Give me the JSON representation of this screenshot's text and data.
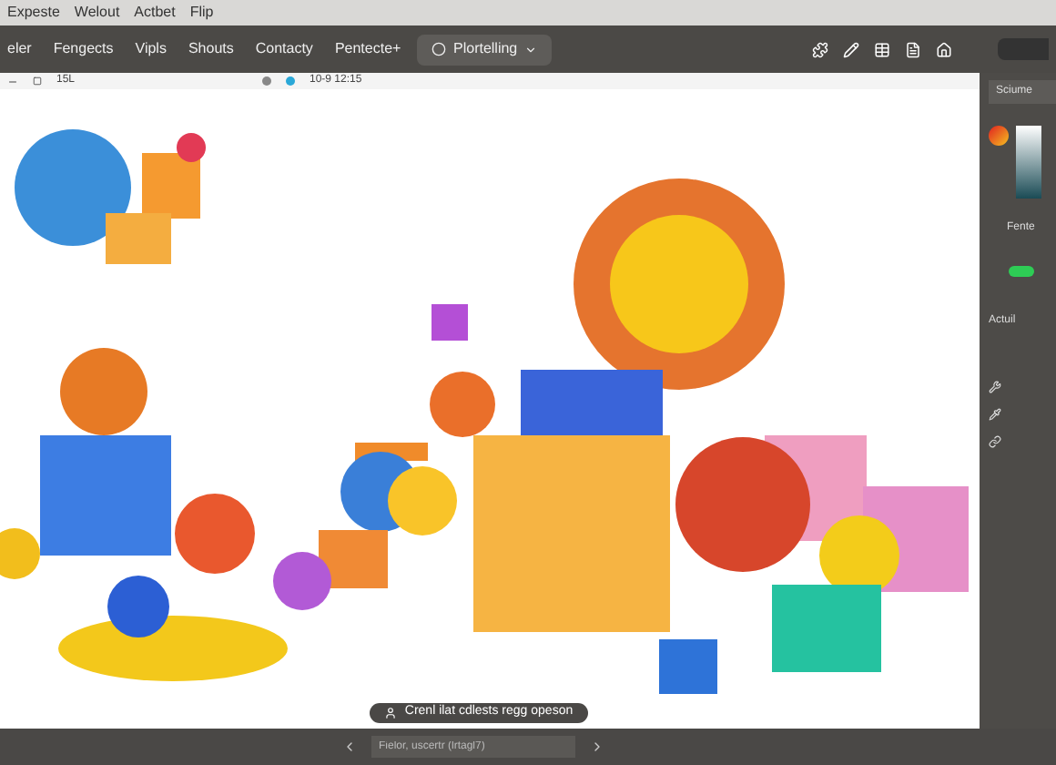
{
  "menu": [
    "Expeste",
    "Welout",
    "Actbet",
    "Flip"
  ],
  "nav": [
    "eler",
    "Fengects",
    "Vipls",
    "Shouts",
    "Contacty",
    "Pentecte+"
  ],
  "dropdown": {
    "label": "Plortelling"
  },
  "info": {
    "size": "15L",
    "time": "10-9 12:15"
  },
  "panel": {
    "tab": "Sciume",
    "section": "Fente",
    "tab2": "Actuil",
    "toggle_on": true
  },
  "toast": "Crenl ilat cdlests regg opeson",
  "prompt": {
    "placeholder": "Fielor, uscertr (lrtagl7)"
  }
}
